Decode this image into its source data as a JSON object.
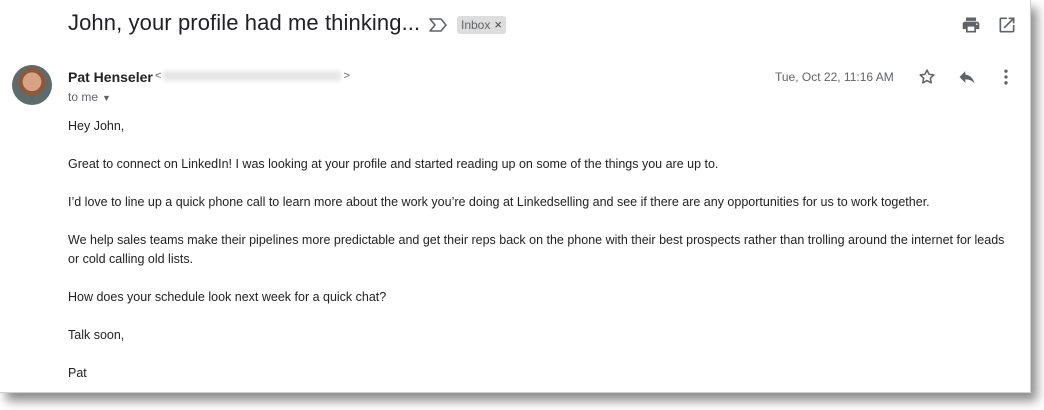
{
  "email": {
    "subject": "John, your profile had me thinking...",
    "label": "Inbox",
    "label_close": "×",
    "sender": {
      "name": "Pat Henseler",
      "email_open": "<",
      "email_close": ">"
    },
    "recipient": "to me",
    "date": "Tue, Oct 22, 11:16 AM",
    "body": [
      "Hey John,",
      "Great to connect on LinkedIn! I was looking at your profile and started reading up on some of the things you are up to.",
      "I’d love to line up a quick phone call to learn more about the work you’re doing at Linkedselling and see if there are any opportunities for us to work together.",
      "We help sales teams make their pipelines more predictable and get their reps back on the phone with their best prospects rather than trolling around the internet for leads or cold calling old lists.",
      "How does your schedule look next week for a quick chat?",
      "Talk soon,",
      "Pat"
    ]
  },
  "icons": {
    "importance": "importance-marker-icon",
    "print": "print-icon",
    "open_new": "open-in-new-window-icon",
    "star": "star-icon",
    "reply": "reply-icon",
    "more": "more-vert-icon"
  },
  "colors": {
    "text": "#202124",
    "muted": "#5f6368",
    "chip": "#dddddd"
  }
}
